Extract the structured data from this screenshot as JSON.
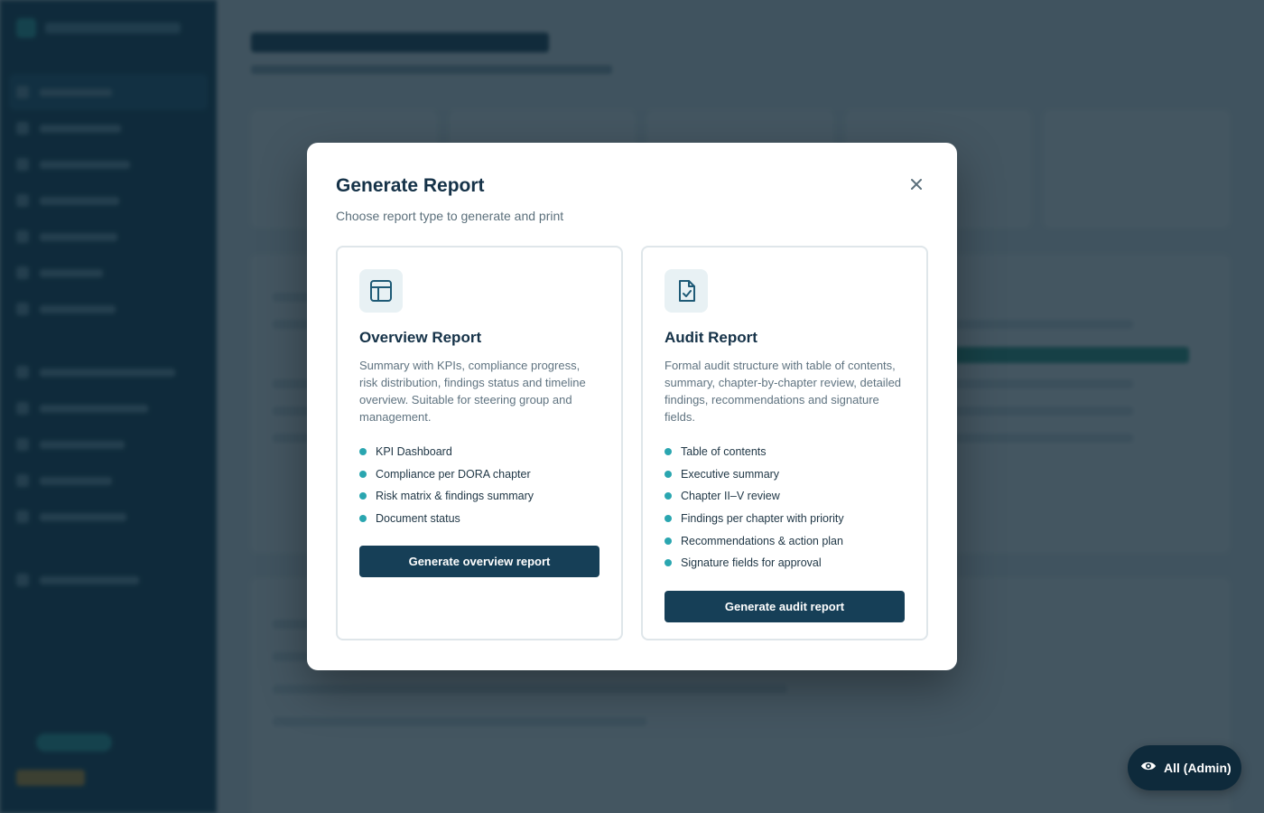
{
  "modal": {
    "title": "Generate Report",
    "subtitle": "Choose report type to generate and print",
    "close_icon": "close-icon"
  },
  "cards": [
    {
      "icon": "table-icon",
      "title": "Overview Report",
      "description": "Summary with KPIs, compliance progress, risk distribution, findings status and timeline overview. Suitable for steering group and management.",
      "features": [
        "KPI Dashboard",
        "Compliance per DORA chapter",
        "Risk matrix & findings summary",
        "Document status"
      ],
      "button_label": "Generate overview report"
    },
    {
      "icon": "file-check-icon",
      "title": "Audit Report",
      "description": "Formal audit structure with table of contents, summary, chapter-by-chapter review, detailed findings, recommendations and signature fields.",
      "features": [
        "Table of contents",
        "Executive summary",
        "Chapter II–V review",
        "Findings per chapter with priority",
        "Recommendations & action plan",
        "Signature fields for approval"
      ],
      "button_label": "Generate audit report"
    }
  ],
  "role_switcher": {
    "icon": "eye-icon",
    "label": "All (Admin)"
  },
  "colors": {
    "primary": "#163f57",
    "accent": "#2aa6b0",
    "sidebar": "#0f3a52"
  }
}
